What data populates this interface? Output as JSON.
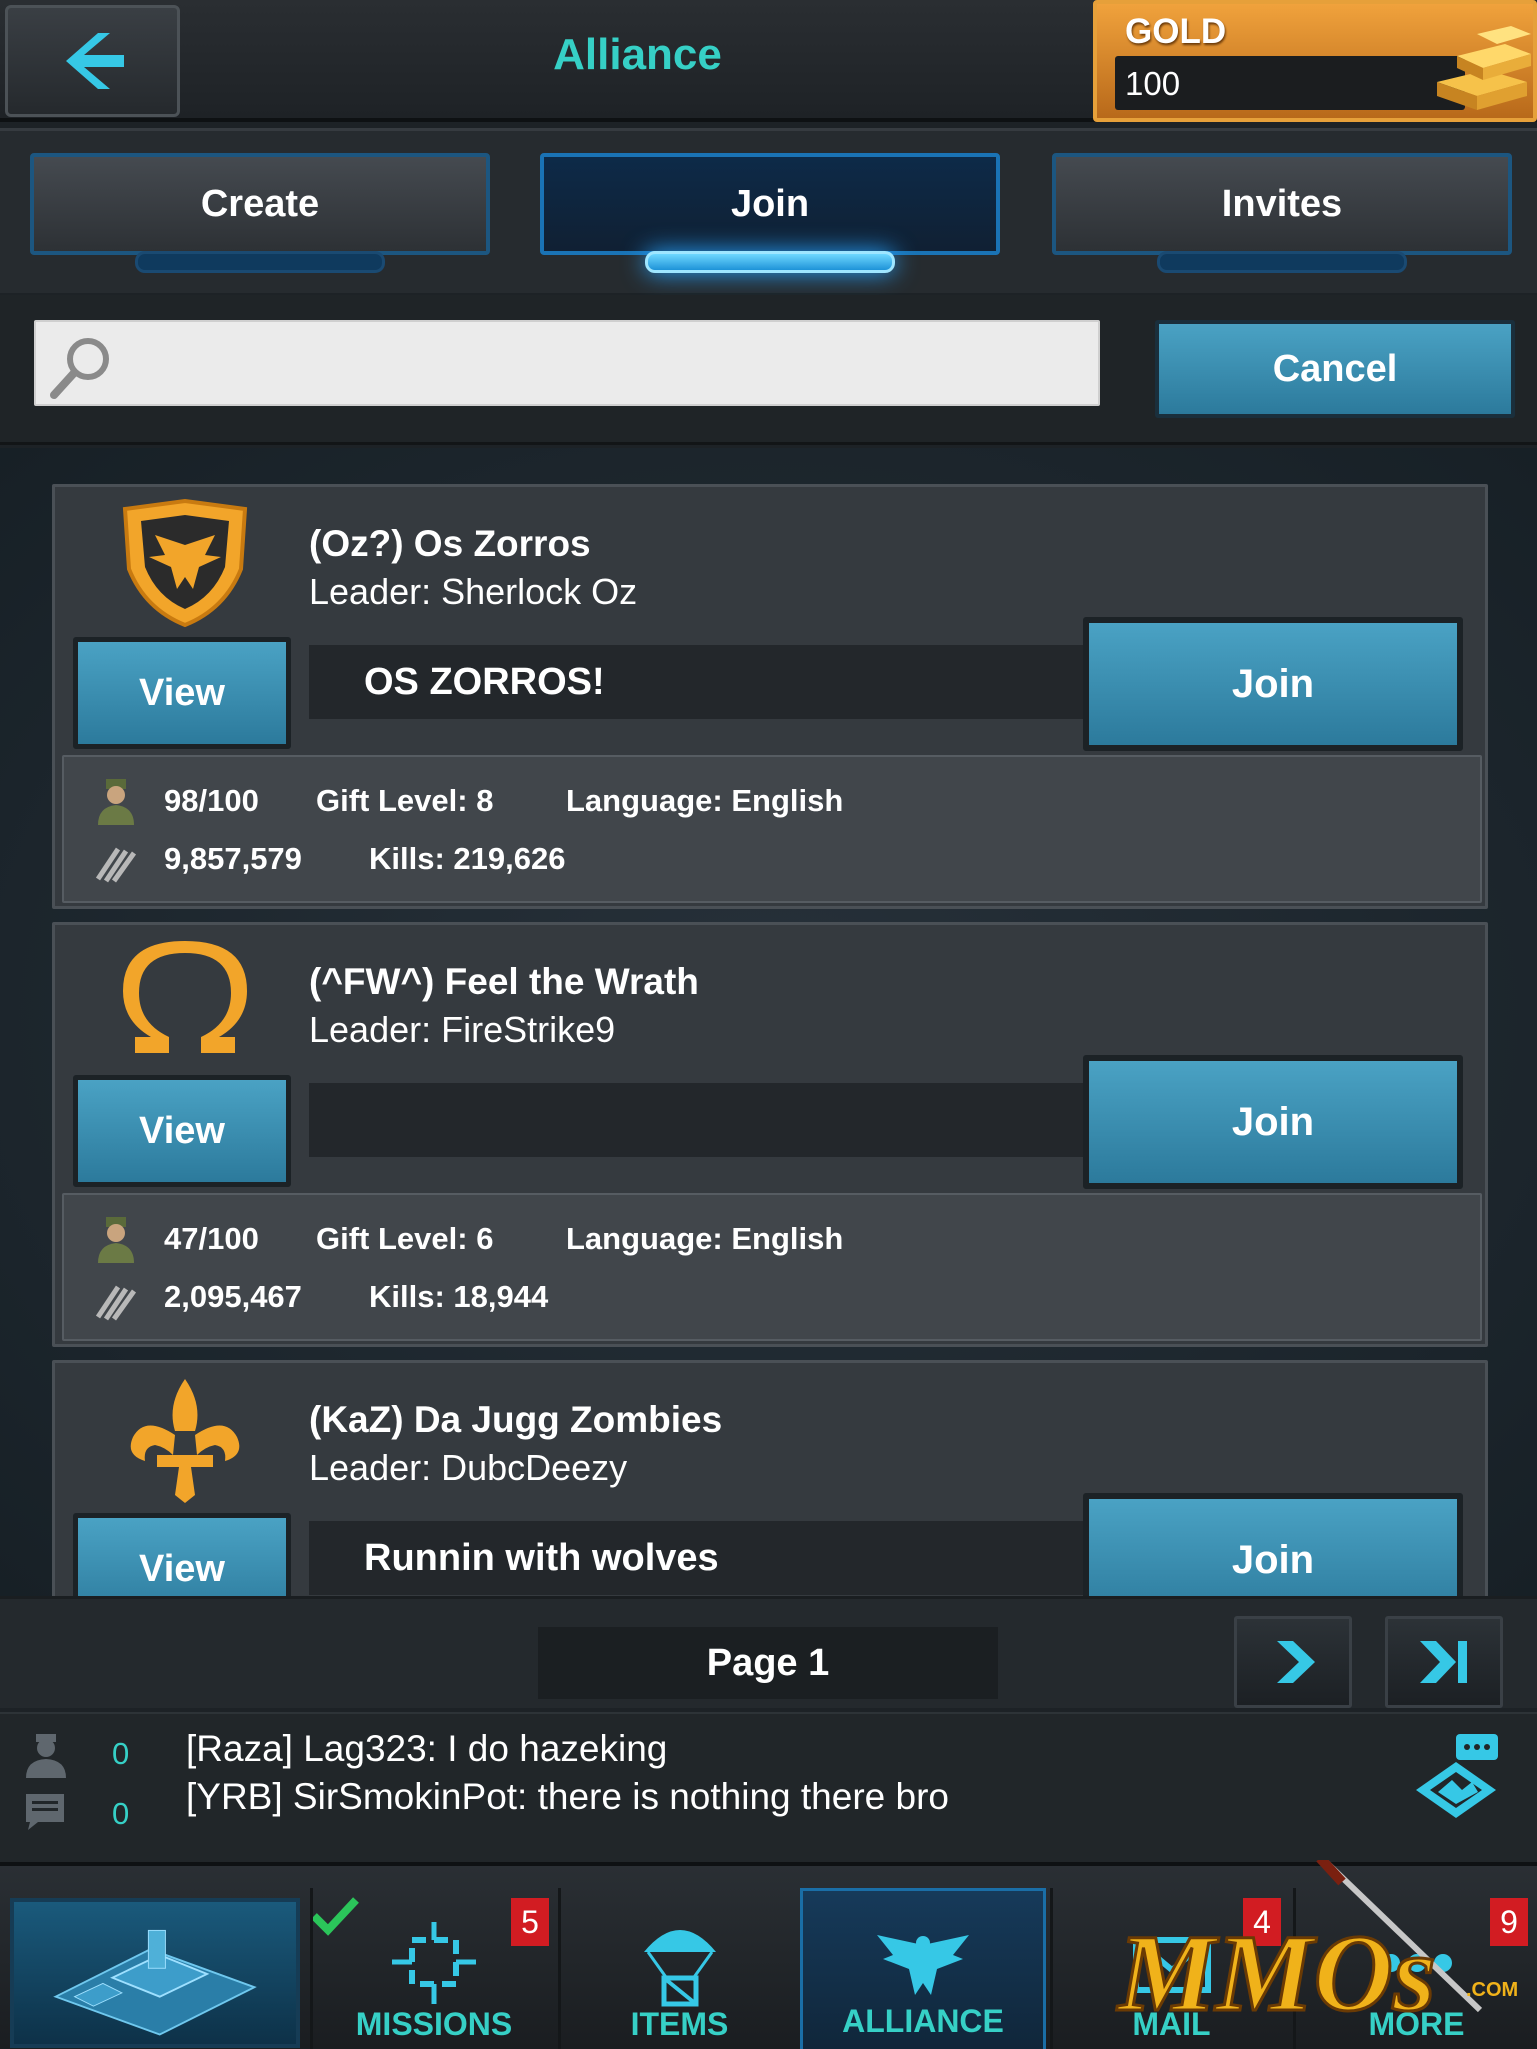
{
  "header": {
    "title": "Alliance",
    "gold_label": "GOLD",
    "gold_value": "100"
  },
  "tabs": [
    {
      "label": "Create",
      "active": false
    },
    {
      "label": "Join",
      "active": true
    },
    {
      "label": "Invites",
      "active": false
    }
  ],
  "search": {
    "value": "",
    "placeholder": "",
    "cancel_label": "Cancel"
  },
  "alliances": [
    {
      "name": "(Oz?) Os Zorros",
      "leader": "Leader: Sherlock Oz",
      "motto": "OS  ZORROS!",
      "view_label": "View",
      "join_label": "Join",
      "members": "98/100",
      "gift_level": "Gift Level: 8",
      "language": "Language: English",
      "power": "9,857,579",
      "kills": "Kills: 219,626",
      "emblem": "eagle-shield-icon"
    },
    {
      "name": "(^FW^) Feel the Wrath",
      "leader": "Leader: FireStrike9",
      "motto": "",
      "view_label": "View",
      "join_label": "Join",
      "members": "47/100",
      "gift_level": "Gift Level: 6",
      "language": "Language: English",
      "power": "2,095,467",
      "kills": "Kills: 18,944",
      "emblem": "omega-icon"
    },
    {
      "name": "(KaZ) Da Jugg Zombies",
      "leader": "Leader: DubcDeezy",
      "motto": "Runnin with wolves",
      "view_label": "View",
      "join_label": "Join",
      "emblem": "fleur-de-lis-icon"
    }
  ],
  "pagination": {
    "label": "Page 1"
  },
  "chat": {
    "count_players": "0",
    "count_messages": "0",
    "lines": [
      "[Raza] Lag323: I do hazeking",
      "[YRB] SirSmokinPot: there is nothing there bro"
    ]
  },
  "nav": {
    "missions_label": "MISSIONS",
    "missions_badge": "5",
    "items_label": "ITEMS",
    "alliance_label": "ALLIANCE",
    "mail_label": "MAIL",
    "mail_badge": "4",
    "more_label": "MORE",
    "more_badge": "9"
  },
  "watermark": {
    "text": "MMOs",
    "suffix": ".COM"
  },
  "colors": {
    "accent_teal": "#36d0c6",
    "button_blue": "#3a8fb2",
    "gold": "#e6a03a",
    "badge_red": "#d21c22"
  }
}
